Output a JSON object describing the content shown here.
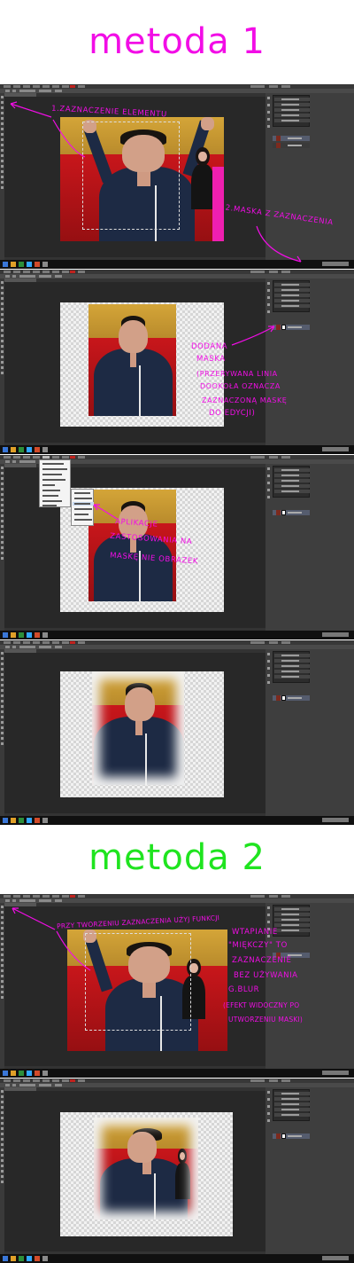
{
  "headings": {
    "method1": "metoda 1",
    "method2": "metoda 2"
  },
  "annotations": {
    "shot1": {
      "step1": "1.ZAZNACZENIE ELEMENTU",
      "step2": "2.MASKA Z ZAZNACZENIA"
    },
    "shot2": {
      "lines": [
        "DODANA",
        "MASKA",
        "(PRZERYWANA LINIA",
        "DOOKOŁA OZNACZA",
        "ZAZNACZONĄ MASKĘ",
        "DO EDYCJI)"
      ]
    },
    "shot3": {
      "lines": [
        "APLIKACJE",
        "ZASTOSOWANIA NA",
        "MASKĘ NIE OBRAZEK"
      ]
    },
    "shot5": {
      "lines": [
        "PRZY TWORZENIU ZAZNACZENIA UŻYJ FUNKCJI",
        "WTAPIANIE",
        "\"MIĘKCZY\" TO",
        "ZAZNACZENIE",
        "BEZ UŻYWANIA",
        "G.BLUR",
        "(EFEKT WIDOCZNY PO",
        "UTWORZENIU MASKI)"
      ]
    }
  },
  "colors": {
    "accent_method1": "#f20de6",
    "accent_method2": "#1fe41f",
    "annotation": "#f20de6",
    "app_background": "#282828",
    "transparency_checker": "#d6d6d6"
  },
  "icons": [
    "window-menu-icon",
    "tool-icon",
    "panel-icon",
    "layer-thumbnail-icon",
    "layer-mask-icon",
    "taskbar-icon",
    "arrow-icon"
  ]
}
